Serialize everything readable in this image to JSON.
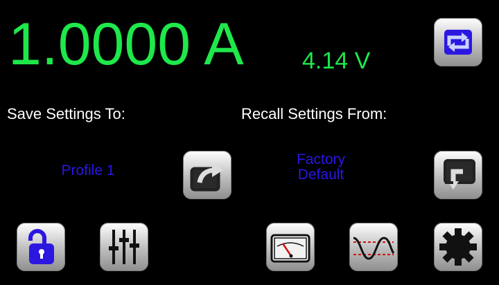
{
  "readout": {
    "current": "1.0000 A",
    "voltage": "4.14 V",
    "color": "#1ee84a"
  },
  "save": {
    "label": "Save Settings To:",
    "target_line1": "Profile 1",
    "icon": "export-icon"
  },
  "recall": {
    "label": "Recall Settings From:",
    "source_line1": "Factory",
    "source_line2": "Default",
    "icon": "import-icon"
  },
  "profile_color": "#2a16e6",
  "buttons": {
    "swap": "swap-icon",
    "lock": "unlock-icon",
    "sliders": "sliders-icon",
    "meter": "meter-icon",
    "waveform": "waveform-icon",
    "settings": "gear-icon"
  }
}
